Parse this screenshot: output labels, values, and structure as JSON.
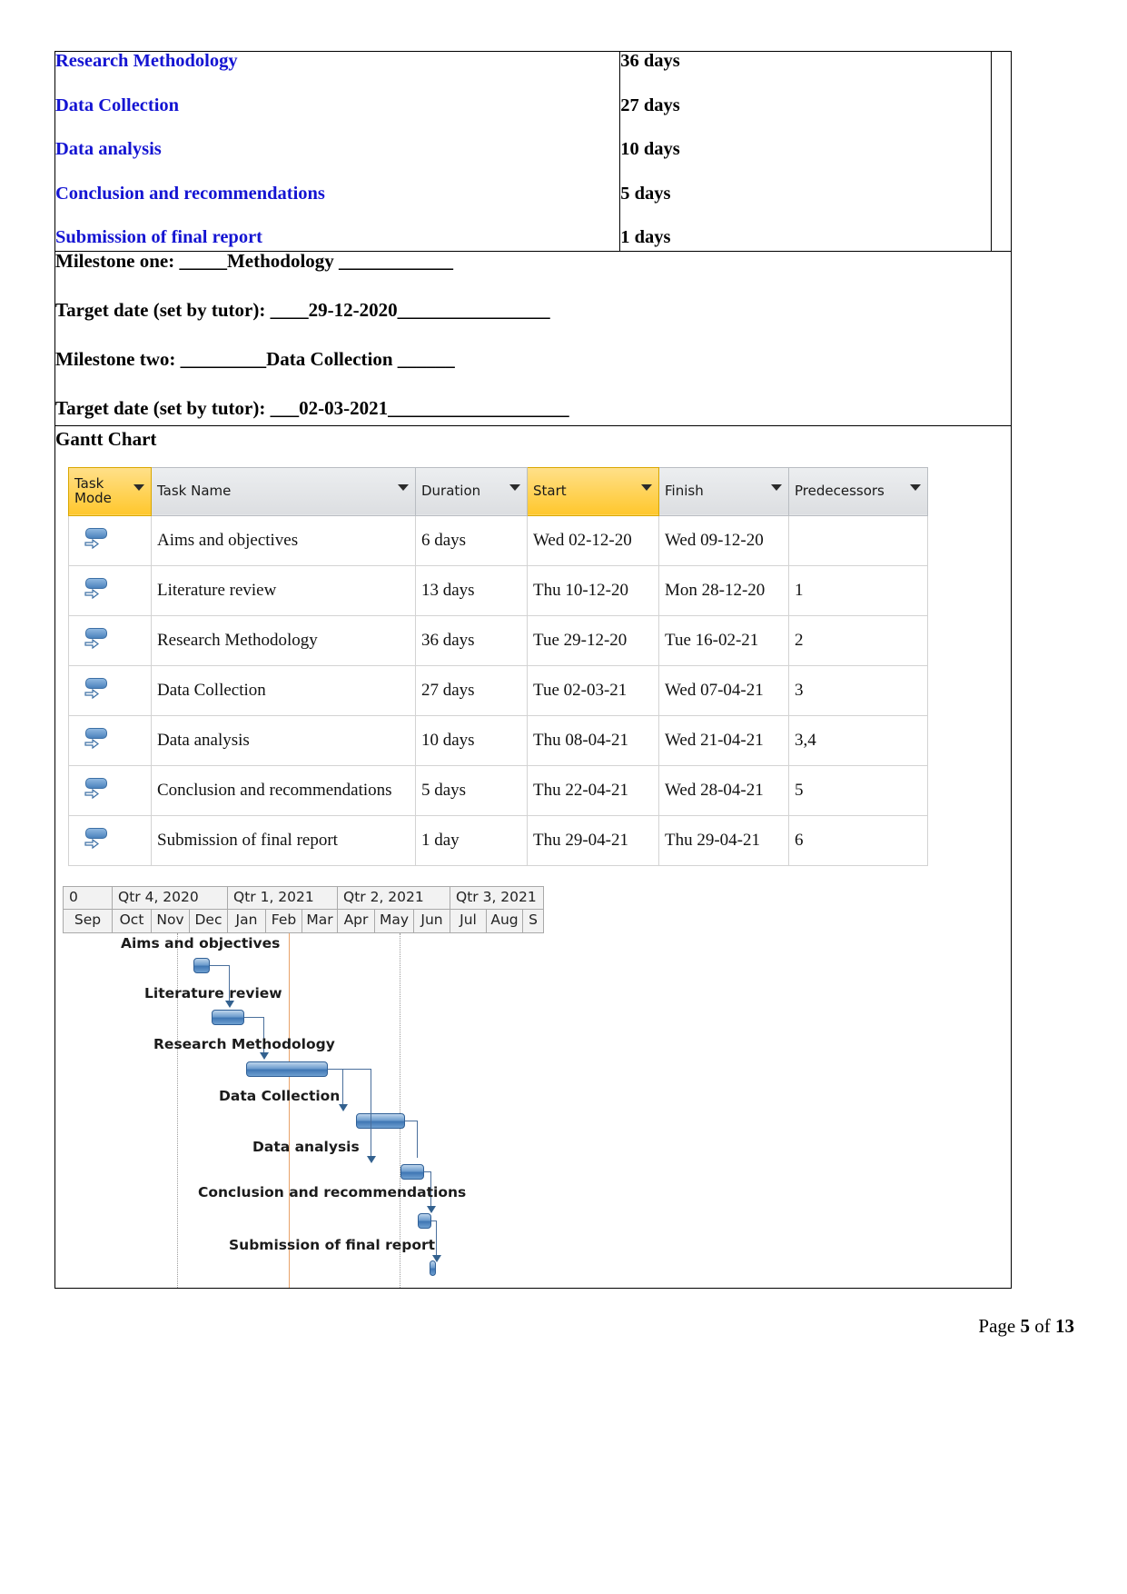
{
  "tasks_table": {
    "rows": [
      {
        "name": "Research Methodology",
        "days": "36 days"
      },
      {
        "name": "Data Collection",
        "days": "27 days"
      },
      {
        "name": "Data analysis",
        "days": "10 days"
      },
      {
        "name": "Conclusion and recommendations",
        "days": "5 days"
      },
      {
        "name": "Submission of final report",
        "days": "1 days"
      }
    ]
  },
  "milestones": {
    "line1": "Milestone one:  _____Methodology ____________",
    "line2": "Target date (set by tutor): ____29-12-2020________________",
    "line3": "Milestone two: _________Data Collection ______",
    "line4": "Target date (set by tutor): ___02-03-2021___________________"
  },
  "gantt": {
    "heading": "Gantt Chart",
    "columns": [
      {
        "label": "Task Mode",
        "highlight": true
      },
      {
        "label": "Task Name",
        "highlight": false
      },
      {
        "label": "Duration",
        "highlight": false
      },
      {
        "label": "Start",
        "highlight": true
      },
      {
        "label": "Finish",
        "highlight": false
      },
      {
        "label": "Predecessors",
        "highlight": false
      }
    ],
    "rows": [
      {
        "mode": "auto-schedule-icon",
        "name": "Aims and objectives",
        "duration": "6 days",
        "start": "Wed 02-12-20",
        "finish": "Wed 09-12-20",
        "predecessors": "",
        "selected": false
      },
      {
        "mode": "auto-schedule-icon",
        "name": "Literature review",
        "duration": "13 days",
        "start": "Thu 10-12-20",
        "finish": "Mon 28-12-20",
        "predecessors": "1",
        "selected": false
      },
      {
        "mode": "auto-schedule-icon",
        "name": "Research Methodology",
        "duration": "36 days",
        "start": "Tue 29-12-20",
        "finish": "Tue 16-02-21",
        "predecessors": "2",
        "selected": false
      },
      {
        "mode": "auto-schedule-icon",
        "name": "Data Collection",
        "duration": "27 days",
        "start": "Tue 02-03-21",
        "finish": "Wed 07-04-21",
        "predecessors": "3",
        "selected": false
      },
      {
        "mode": "auto-schedule-icon",
        "name": "Data analysis",
        "duration": "10 days",
        "start": "Thu 08-04-21",
        "finish": "Wed 21-04-21",
        "predecessors": "3,4",
        "selected": true
      },
      {
        "mode": "auto-schedule-icon",
        "name": "Conclusion and recommendations",
        "duration": "5 days",
        "start": "Thu 22-04-21",
        "finish": "Wed 28-04-21",
        "predecessors": "5",
        "selected": true
      },
      {
        "mode": "auto-schedule-icon",
        "name": "Submission of final report",
        "duration": "1 day",
        "start": "Thu 29-04-21",
        "finish": "Thu 29-04-21",
        "predecessors": "6",
        "selected": true
      }
    ]
  },
  "chart_data": {
    "type": "bar",
    "title": "Gantt Chart",
    "xlabel": "",
    "ylabel": "",
    "timeline": {
      "leading_label": "0",
      "quarters": [
        {
          "label": "Qtr 4, 2020",
          "months": [
            "Oct",
            "Nov",
            "Dec"
          ]
        },
        {
          "label": "Qtr 1, 2021",
          "months": [
            "Jan",
            "Feb",
            "Mar"
          ]
        },
        {
          "label": "Qtr 2, 2021",
          "months": [
            "Apr",
            "May",
            "Jun"
          ]
        },
        {
          "label": "Qtr 3, 2021",
          "months": [
            "Jul",
            "Aug",
            "S"
          ]
        }
      ],
      "pre_month": "Sep"
    },
    "categories": [
      "Aims and objectives",
      "Literature review",
      "Research Methodology",
      "Data Collection",
      "Data analysis",
      "Conclusion and recommendations",
      "Submission of final report"
    ],
    "bars": [
      {
        "label": "Aims and objectives",
        "start": "Wed 02-12-20",
        "finish": "Wed 09-12-20",
        "duration_days": 6,
        "left_pct": 23.5,
        "width_pct": 3.6
      },
      {
        "label": "Literature review",
        "start": "Thu 10-12-20",
        "finish": "Mon 28-12-20",
        "duration_days": 13,
        "left_pct": 27.2,
        "width_pct": 7.0
      },
      {
        "label": "Research Methodology",
        "start": "Tue 29-12-20",
        "finish": "Tue 16-02-21",
        "duration_days": 36,
        "left_pct": 34.5,
        "width_pct": 17.5
      },
      {
        "label": "Data Collection",
        "start": "Tue 02-03-21",
        "finish": "Wed 07-04-21",
        "duration_days": 27,
        "left_pct": 55.5,
        "width_pct": 13.0
      },
      {
        "label": "Data analysis",
        "start": "Thu 08-04-21",
        "finish": "Wed 21-04-21",
        "duration_days": 10,
        "left_pct": 68.8,
        "width_pct": 5.2
      },
      {
        "label": "Conclusion and recommendations",
        "start": "Thu 22-04-21",
        "finish": "Wed 28-04-21",
        "duration_days": 5,
        "left_pct": 74.2,
        "width_pct": 2.8
      },
      {
        "label": "Submission of final report",
        "start": "Thu 29-04-21",
        "finish": "Thu 29-04-21",
        "duration_days": 1,
        "left_pct": 76.8,
        "width_pct": 1.0
      }
    ]
  },
  "footer": {
    "prefix": "Page",
    "page": "5",
    "middle": "of",
    "total": "13"
  }
}
